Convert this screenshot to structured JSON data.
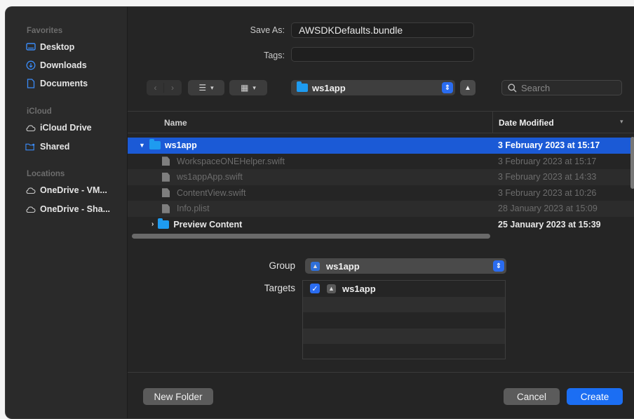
{
  "sidebar": {
    "sections": {
      "favorites": "Favorites",
      "icloud": "iCloud",
      "locations": "Locations"
    },
    "items": [
      {
        "label": "Desktop",
        "icon": "desktop-icon"
      },
      {
        "label": "Downloads",
        "icon": "downloads-icon"
      },
      {
        "label": "Documents",
        "icon": "documents-icon"
      },
      {
        "label": "iCloud Drive",
        "icon": "cloud-icon"
      },
      {
        "label": "Shared",
        "icon": "shared-folder-icon"
      },
      {
        "label": "OneDrive - VM...",
        "icon": "cloud-icon"
      },
      {
        "label": "OneDrive - Sha...",
        "icon": "cloud-icon"
      }
    ]
  },
  "form": {
    "save_as_label": "Save As:",
    "save_as_value": "AWSDKDefaults.bundle",
    "tags_label": "Tags:",
    "tags_value": ""
  },
  "toolbar": {
    "location": "ws1app",
    "search_placeholder": "Search"
  },
  "table": {
    "headers": {
      "name": "Name",
      "date": "Date Modified"
    },
    "rows": [
      {
        "name": "ws1app",
        "date": "3 February 2023 at 15:17",
        "type": "folder",
        "state": "selected-expanded"
      },
      {
        "name": "WorkspaceONEHelper.swift",
        "date": "3 February 2023 at 15:17",
        "type": "file",
        "state": "disabled"
      },
      {
        "name": "ws1appApp.swift",
        "date": "3 February 2023 at 14:33",
        "type": "file",
        "state": "disabled"
      },
      {
        "name": "ContentView.swift",
        "date": "3 February 2023 at 10:26",
        "type": "file",
        "state": "disabled"
      },
      {
        "name": "Info.plist",
        "date": "28 January 2023 at 15:09",
        "type": "file",
        "state": "disabled"
      },
      {
        "name": "Preview Content",
        "date": "25 January 2023 at 15:39",
        "type": "folder",
        "state": "collapsed"
      }
    ]
  },
  "options": {
    "group_label": "Group",
    "group_value": "ws1app",
    "targets_label": "Targets",
    "targets": [
      {
        "label": "ws1app",
        "checked": true
      }
    ]
  },
  "buttons": {
    "new_folder": "New Folder",
    "cancel": "Cancel",
    "create": "Create"
  },
  "colors": {
    "accent": "#1b6ef3",
    "selection": "#1b5ad6",
    "folder": "#1e9bf0"
  }
}
